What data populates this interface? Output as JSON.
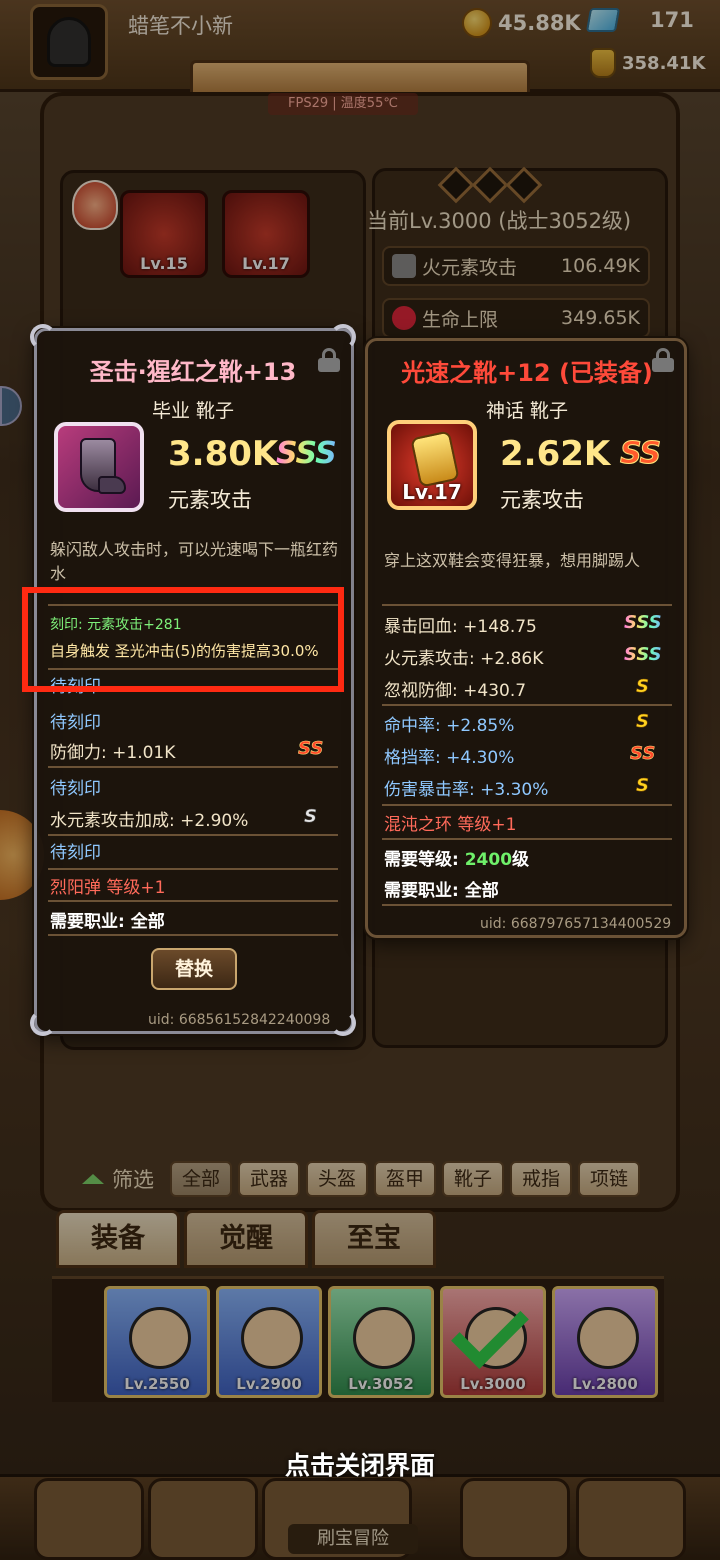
{
  "player": {
    "name": "蜡笔不小新",
    "gold": "45.88K",
    "gems": "171",
    "bag": "358.41K"
  },
  "fps_tag": "FPS29 | 温度55℃",
  "background": {
    "current_level": "当前Lv.3000 (战士3052级)",
    "stats": [
      {
        "label": "火元素攻击",
        "value": "106.49K"
      },
      {
        "label": "生命上限",
        "value": "349.65K"
      }
    ],
    "slots": [
      {
        "lv": "Lv.15"
      },
      {
        "lv": "Lv.17"
      }
    ],
    "filter_label": "筛选",
    "filters": [
      "全部",
      "武器",
      "头盔",
      "盔甲",
      "靴子",
      "戒指",
      "项链"
    ],
    "tabs": [
      "装备",
      "觉醒",
      "至宝"
    ],
    "heroes": [
      {
        "lv": "Lv.2550"
      },
      {
        "lv": "Lv.2900"
      },
      {
        "lv": "Lv.3052"
      },
      {
        "lv": "Lv.3000"
      },
      {
        "lv": "Lv.2800"
      }
    ],
    "close_hint": "点击关闭界面",
    "nav_label": "刷宝冒险"
  },
  "left_card": {
    "title": "圣击·猩红之靴+13",
    "subtitle": "毕业 靴子",
    "power": "3.80K",
    "rank": "SSS",
    "power_type": "元素攻击",
    "description": "躲闪敌人攻击时，可以光速喝下一瓶红药水",
    "engrave_label": "刻印: 元素攻击+281",
    "engrave_effect": "自身触发 圣光冲击(5)的伤害提高30.0%",
    "lines": [
      {
        "text": "待刻印",
        "color": "blue"
      },
      {
        "text": "待刻印",
        "color": "blue"
      },
      {
        "text": "防御力: +1.01K",
        "color": "white",
        "badge": "SS"
      },
      {
        "text": "待刻印",
        "color": "blue"
      },
      {
        "text": "水元素攻击加成: +2.90%",
        "color": "white",
        "badge": "S"
      },
      {
        "text": "待刻印",
        "color": "blue"
      },
      {
        "text": "烈阳弹 等级+1",
        "color": "red"
      },
      {
        "text": "需要职业: 全部",
        "color": "bold"
      }
    ],
    "replace_button": "替换",
    "uid": "uid: 66856152842240098"
  },
  "right_card": {
    "title": "光速之靴+12 (已装备)",
    "subtitle": "神话 靴子",
    "item_lv": "Lv.17",
    "power": "2.62K",
    "rank": "SS",
    "power_type": "元素攻击",
    "description": "穿上这双鞋会变得狂暴，想用脚踢人",
    "lines": [
      {
        "text": "暴击回血: +148.75",
        "color": "white",
        "badge": "SSS"
      },
      {
        "text": "火元素攻击: +2.86K",
        "color": "white",
        "badge": "SSS"
      },
      {
        "text": "忽视防御: +430.7",
        "color": "white",
        "badge": "S"
      },
      {
        "text": "命中率: +2.85%",
        "color": "blue",
        "badge": "S"
      },
      {
        "text": "格挡率: +4.30%",
        "color": "blue",
        "badge": "SS"
      },
      {
        "text": "伤害暴击率: +3.30%",
        "color": "blue",
        "badge": "S"
      },
      {
        "text": "混沌之环 等级+1",
        "color": "red"
      }
    ],
    "level_req_prefix": "需要等级: ",
    "level_req_value": "2400",
    "level_req_suffix": "级",
    "job_req": "需要职业: 全部",
    "uid": "uid: 668797657134400529"
  }
}
